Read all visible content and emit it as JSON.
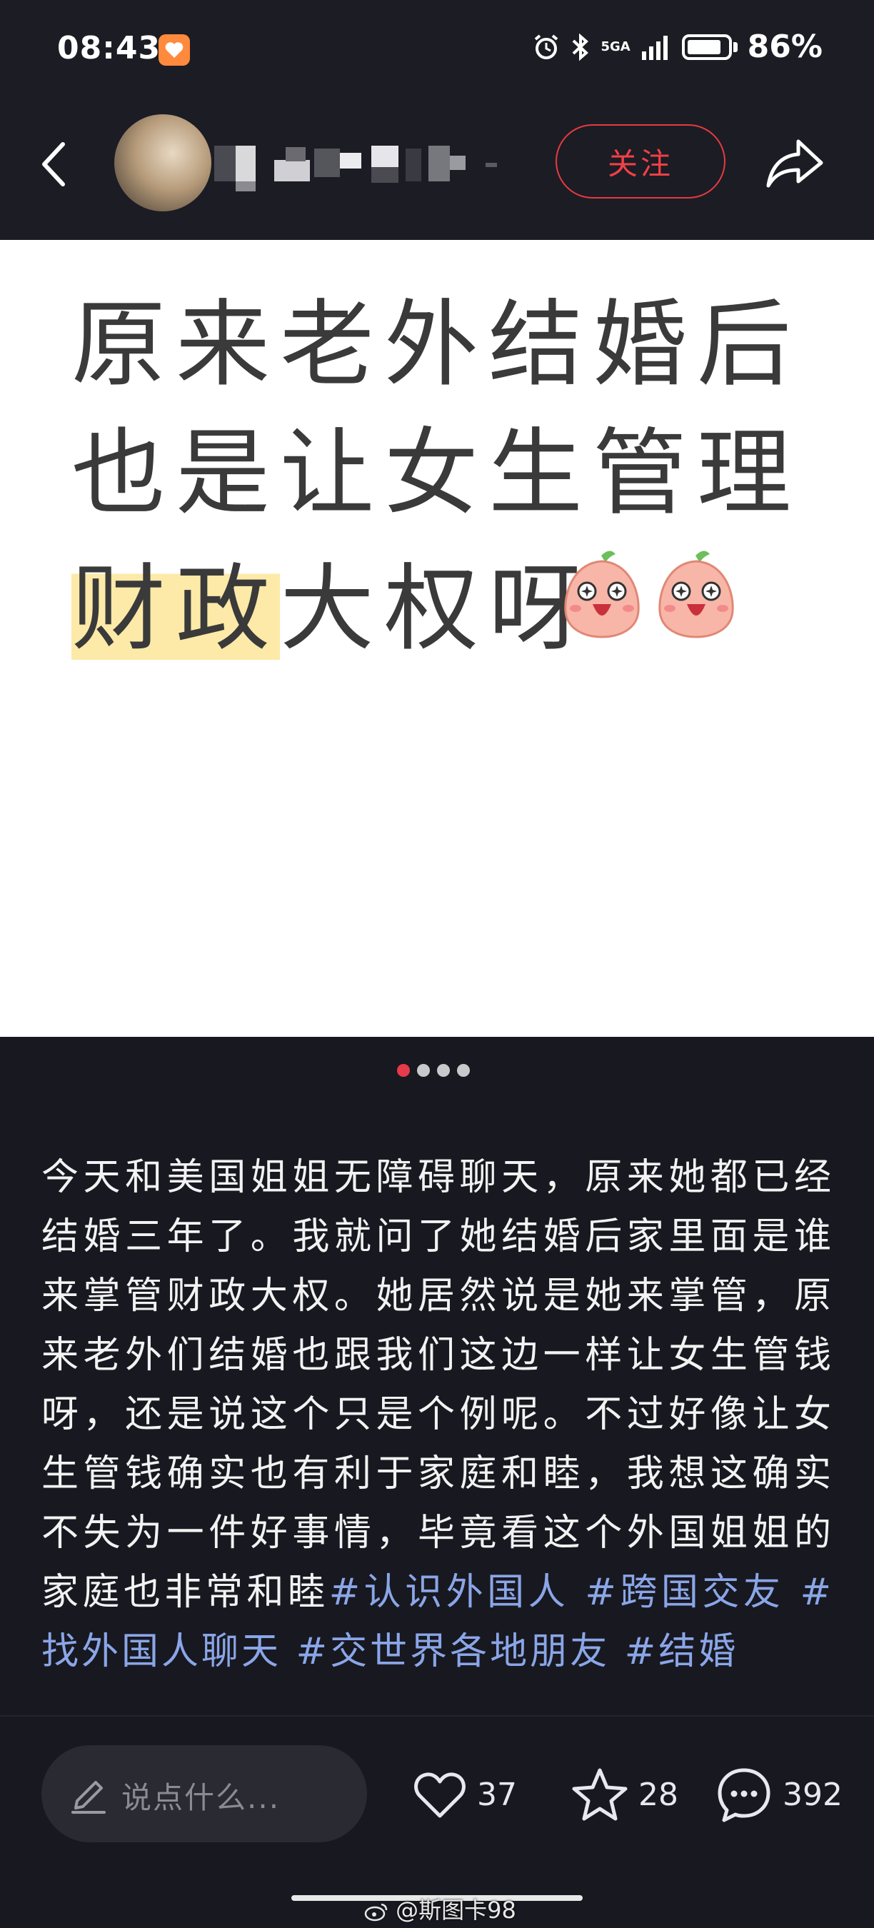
{
  "status_bar": {
    "time": "08:43",
    "network": "5GA",
    "battery_percent": "86%",
    "battery_level": 0.86
  },
  "header": {
    "follow_label": "关注"
  },
  "post_image": {
    "lines": [
      "原来老外结婚后",
      "也是让女生管理"
    ],
    "line3_highlight": "财政",
    "line3_rest": "大权呀"
  },
  "carousel": {
    "count": 4,
    "active_index": 0
  },
  "post": {
    "body": "今天和美国姐姐无障碍聊天，原来她都已经结婚三年了。我就问了她结婚后家里面是谁来掌管财政大权。她居然说是她来掌管，原来老外们结婚也跟我们这边一样让女生管钱呀，还是说这个只是个例呢。不过好像让女生管钱确实也有利于家庭和睦，我想这确实不失为一件好事情，毕竟看这个外国姐姐的家庭也非常和睦",
    "hashtags": [
      "#认识外国人",
      "#跨国交友",
      "#找外国人聊天",
      "#交世界各地朋友",
      "#结婚"
    ]
  },
  "bottom_bar": {
    "comment_placeholder": "说点什么...",
    "likes": "37",
    "favorites": "28",
    "comments": "392"
  },
  "watermark": {
    "text": "@斯图卡98"
  },
  "colors": {
    "background": "#181820",
    "accent_red": "#e83a3f",
    "hashtag_blue": "#8aa6e8",
    "highlight_yellow": "#fdeaa8"
  }
}
